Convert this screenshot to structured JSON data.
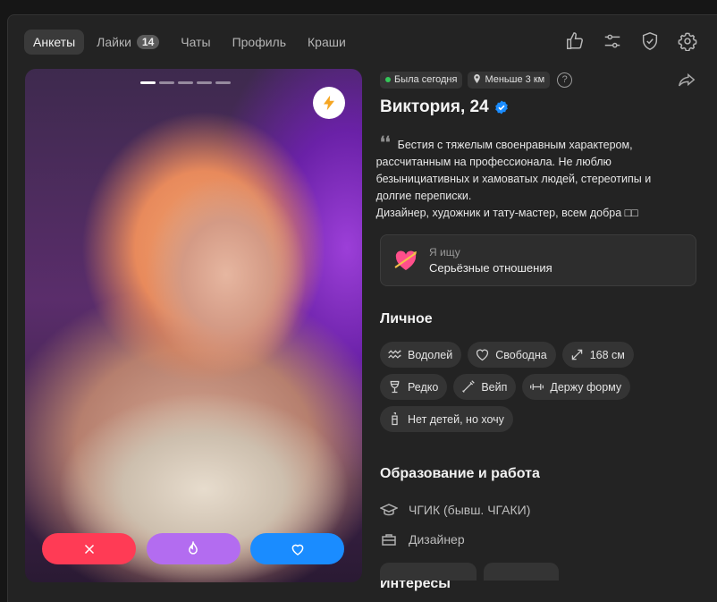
{
  "nav": {
    "tabs": [
      {
        "label": "Анкеты",
        "active": true
      },
      {
        "label": "Лайки",
        "badge": "14"
      },
      {
        "label": "Чаты"
      },
      {
        "label": "Профиль"
      },
      {
        "label": "Краши"
      }
    ],
    "icons": [
      "thumbs-up-icon",
      "filters-icon",
      "shield-check-icon",
      "gear-icon"
    ]
  },
  "photo": {
    "dots": 5,
    "active_dot": 0,
    "boost_icon": "lightning-icon",
    "actions": [
      "dislike",
      "super-like",
      "like"
    ]
  },
  "profile": {
    "status": "Была сегодня",
    "distance": "Меньше 3 км",
    "help": "?",
    "name": "Виктория, 24",
    "bio": "Бестия с тяжелым своенравным характером,\nрассчитанным на профессионала. Не люблю\nбезынициативных и хамоватых людей, стереотипы и\nдолгие переписки.\nДизайнер, художник и тату-мастер, всем добра □□",
    "looking": {
      "label": "Я ищу",
      "value": "Серьёзные отношения"
    }
  },
  "personal": {
    "title": "Личное",
    "tags": [
      {
        "icon": "aquarius-icon",
        "label": "Водолей"
      },
      {
        "icon": "heart-outline-icon",
        "label": "Свободна"
      },
      {
        "icon": "height-arrows-icon",
        "label": "168 см"
      },
      {
        "icon": "wine-glass-icon",
        "label": "Редко"
      },
      {
        "icon": "vape-icon",
        "label": "Вейп"
      },
      {
        "icon": "dumbbell-icon",
        "label": "Держу форму"
      },
      {
        "icon": "baby-bottle-icon",
        "label": "Нет детей, но хочу"
      }
    ]
  },
  "education": {
    "title": "Образование и работа",
    "school": "ЧГИК (бывш. ЧГАКИ)",
    "job": "Дизайнер"
  },
  "interests": {
    "title": "Интересы"
  },
  "colors": {
    "background": "#232323",
    "chip": "#343434",
    "dislike": "#ff3b55",
    "super_like": "#b36cf0",
    "like": "#1a8cff",
    "verified": "#1a8cff",
    "online": "#34c759"
  }
}
